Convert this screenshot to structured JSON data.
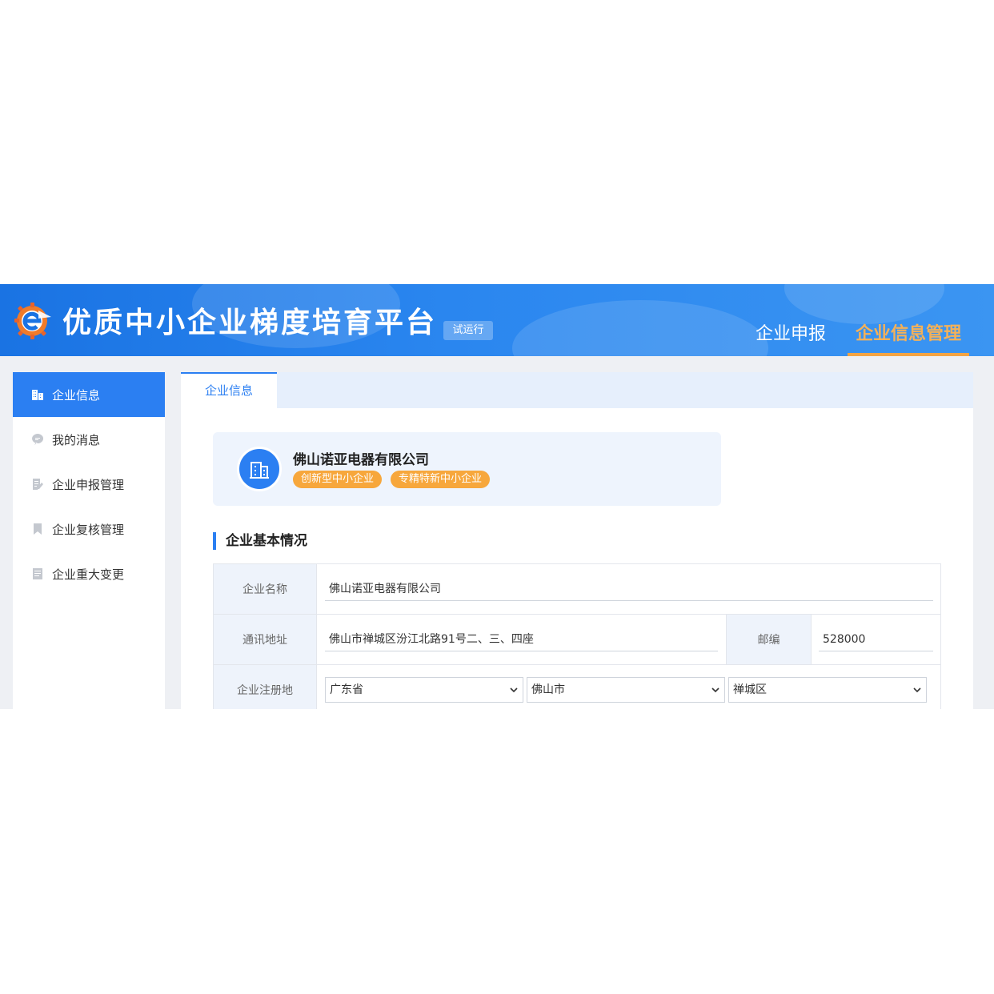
{
  "header": {
    "app_title": "优质中小企业梯度培育平台",
    "trial_badge": "试运行",
    "nav": [
      "企业申报",
      "企业信息管理"
    ],
    "active_nav": "企业信息管理"
  },
  "sidebar": {
    "items": [
      {
        "label": "企业信息",
        "icon": "building-icon",
        "active": true
      },
      {
        "label": "我的消息",
        "icon": "message-icon",
        "active": false
      },
      {
        "label": "企业申报管理",
        "icon": "edit-document-icon",
        "active": false
      },
      {
        "label": "企业复核管理",
        "icon": "bookmark-icon",
        "active": false
      },
      {
        "label": "企业重大变更",
        "icon": "document-icon",
        "active": false
      }
    ]
  },
  "tabs": {
    "active": "企业信息"
  },
  "company": {
    "name": "佛山诺亚电器有限公司",
    "tags": [
      "创新型中小企业",
      "专精特新中小企业"
    ]
  },
  "section": {
    "title": "企业基本情况"
  },
  "form": {
    "company_name_label": "企业名称",
    "company_name_value": "佛山诺亚电器有限公司",
    "address_label": "通讯地址",
    "address_value": "佛山市禅城区汾江北路91号二、三、四座",
    "postcode_label": "邮编",
    "postcode_value": "528000",
    "reg_label": "企业注册地",
    "province": "广东省",
    "city": "佛山市",
    "district": "禅城区"
  },
  "colors": {
    "primary": "#2b7ff2",
    "header_bg": "#1a73e3",
    "accent_orange": "#f3a443",
    "tag_orange": "#f7a73c"
  }
}
